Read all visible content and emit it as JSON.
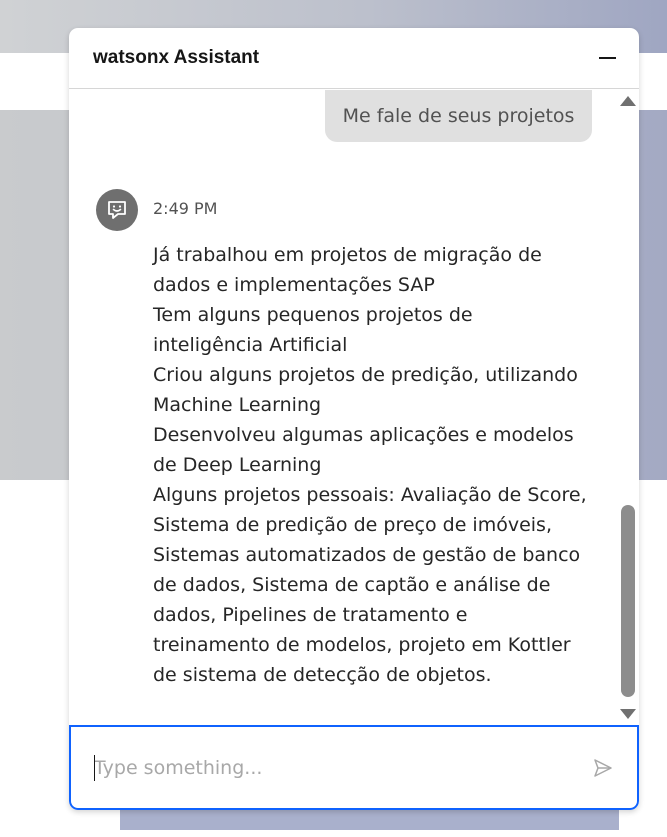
{
  "chat": {
    "title": "watsonx Assistant",
    "user_message": "Me fale de seus projetos",
    "bot_timestamp": "2:49 PM",
    "bot_lines": [
      "Já trabalhou em projetos de migração de",
      "dados e implementações SAP",
      "Tem alguns pequenos projetos de",
      "inteligência Artificial",
      "Criou alguns projetos de predição, utilizando",
      "Machine Learning",
      "Desenvolveu algumas aplicações e modelos",
      "de Deep Learning",
      "Alguns projetos pessoais: Avaliação de Score,",
      "Sistema de predição de preço de imóveis,",
      "Sistemas automatizados de gestão de banco",
      "de dados, Sistema de captão e análise de",
      "dados, Pipelines de tratamento e",
      "treinamento de modelos, projeto em Kottler",
      "de sistema de detecção de objetos."
    ],
    "input_placeholder": "Type something...",
    "icons": {
      "minimize": "minimize-icon",
      "bot_avatar": "chat-bot-icon",
      "send": "send-icon"
    },
    "colors": {
      "accent": "#0f62fe",
      "user_bubble": "#e0e0e0",
      "avatar": "#6f6f6f"
    }
  }
}
